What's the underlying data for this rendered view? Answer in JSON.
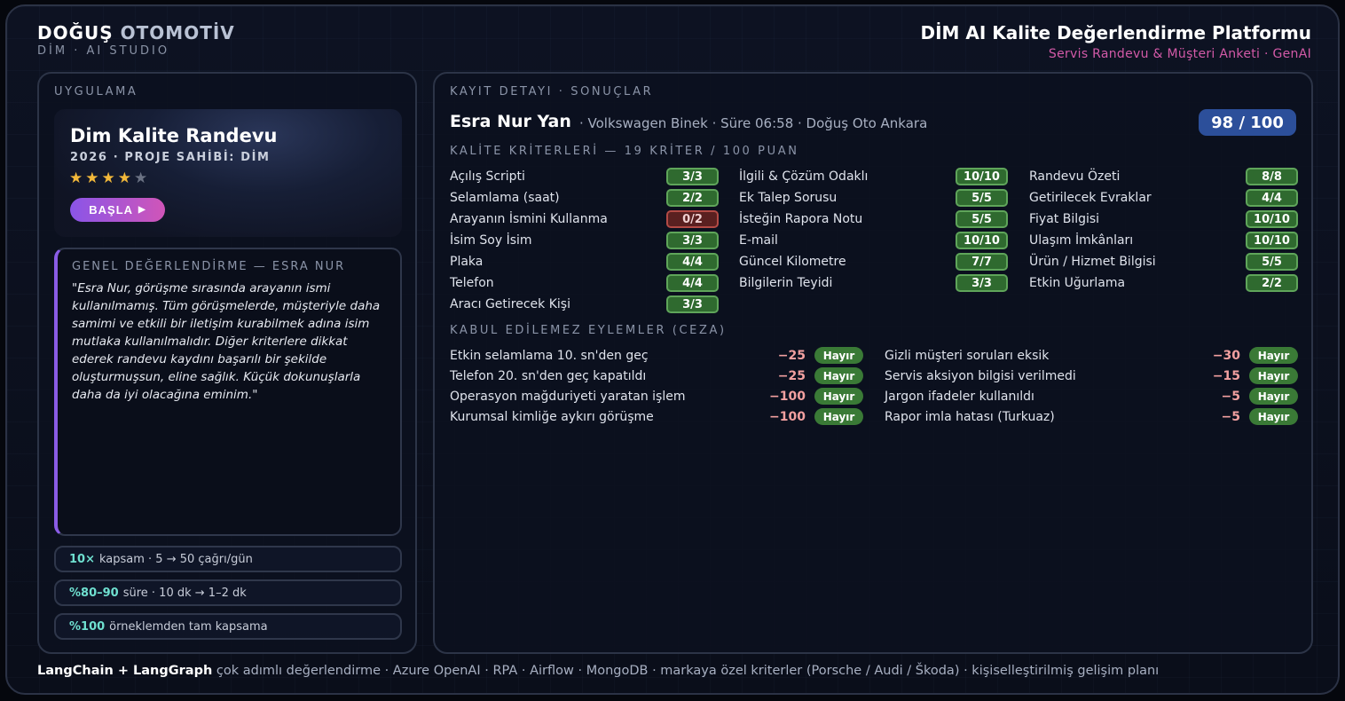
{
  "brand": {
    "name_bold": "DOĞUŞ",
    "name_light": "OTOMOTİV",
    "sub": "DİM · AI STUDIO"
  },
  "platform": {
    "title": "DİM AI Kalite Değerlendirme Platformu",
    "subtitle": "Servis Randevu & Müşteri Anketi · GenAI"
  },
  "left": {
    "caption": "UYGULAMA",
    "app": {
      "title": "Dim Kalite Randevu",
      "owner": "2026 · PROJE SAHİBİ: DİM",
      "rating": 4,
      "rating_max": 5,
      "start_label": "BAŞLA"
    },
    "evaluation": {
      "caption": "GENEL DEĞERLENDİRME — ESRA NUR",
      "text": "\"Esra Nur, görüşme sırasında arayanın ismi kullanılmamış. Tüm görüşmelerde, müşteriyle daha samimi ve etkili bir iletişim kurabilmek adına isim mutlaka kullanılmalıdır. Diğer kriterlere dikkat ederek randevu kaydını başarılı bir şekilde oluşturmuşsun, eline sağlık. Küçük dokunuşlarla daha da iyi olacağına eminim.\""
    },
    "stats": [
      {
        "highlight": "10×",
        "text": "kapsam · 5 → 50 çağrı/gün"
      },
      {
        "highlight": "%80–90",
        "text": "süre · 10 dk → 1–2 dk"
      },
      {
        "highlight": "%100",
        "text": "örneklemden tam kapsama"
      }
    ]
  },
  "right": {
    "caption": "KAYIT DETAYI · SONUÇLAR",
    "record": {
      "name": "Esra Nur Yan",
      "meta": "· Volkswagen Binek · Süre 06:58 · Doğuş Oto Ankara",
      "score": "98 / 100"
    },
    "criteria_caption": "KALİTE KRİTERLERİ — 19 KRİTER / 100 PUAN",
    "criteria_columns": [
      [
        {
          "label": "Açılış Scripti",
          "score": "3/3",
          "pass": true
        },
        {
          "label": "Selamlama (saat)",
          "score": "2/2",
          "pass": true
        },
        {
          "label": "Arayanın İsmini Kullanma",
          "score": "0/2",
          "pass": false
        },
        {
          "label": "İsim Soy İsim",
          "score": "3/3",
          "pass": true
        },
        {
          "label": "Plaka",
          "score": "4/4",
          "pass": true
        },
        {
          "label": "Telefon",
          "score": "4/4",
          "pass": true
        },
        {
          "label": "Aracı Getirecek Kişi",
          "score": "3/3",
          "pass": true
        }
      ],
      [
        {
          "label": "İlgili & Çözüm Odaklı",
          "score": "10/10",
          "pass": true
        },
        {
          "label": "Ek Talep Sorusu",
          "score": "5/5",
          "pass": true
        },
        {
          "label": "İsteğin Rapora Notu",
          "score": "5/5",
          "pass": true
        },
        {
          "label": "E-mail",
          "score": "10/10",
          "pass": true
        },
        {
          "label": "Güncel Kilometre",
          "score": "7/7",
          "pass": true
        },
        {
          "label": "Bilgilerin Teyidi",
          "score": "3/3",
          "pass": true
        }
      ],
      [
        {
          "label": "Randevu Özeti",
          "score": "8/8",
          "pass": true
        },
        {
          "label": "Getirilecek Evraklar",
          "score": "4/4",
          "pass": true
        },
        {
          "label": "Fiyat Bilgisi",
          "score": "10/10",
          "pass": true
        },
        {
          "label": "Ulaşım İmkânları",
          "score": "10/10",
          "pass": true
        },
        {
          "label": "Ürün / Hizmet Bilgisi",
          "score": "5/5",
          "pass": true
        },
        {
          "label": "Etkin Uğurlama",
          "score": "2/2",
          "pass": true
        }
      ]
    ],
    "penalty_caption": "KABUL EDİLEMEZ EYLEMLER (CEZA)",
    "penalty_columns": [
      [
        {
          "label": "Etkin selamlama 10. sn'den geç",
          "points": "−25",
          "status": "Hayır"
        },
        {
          "label": "Telefon 20. sn'den geç kapatıldı",
          "points": "−25",
          "status": "Hayır"
        },
        {
          "label": "Operasyon mağduriyeti yaratan işlem",
          "points": "−100",
          "status": "Hayır"
        },
        {
          "label": "Kurumsal kimliğe aykırı görüşme",
          "points": "−100",
          "status": "Hayır"
        }
      ],
      [
        {
          "label": "Gizli müşteri soruları eksik",
          "points": "−30",
          "status": "Hayır"
        },
        {
          "label": "Servis aksiyon bilgisi verilmedi",
          "points": "−15",
          "status": "Hayır"
        },
        {
          "label": "Jargon ifadeler kullanıldı",
          "points": "−5",
          "status": "Hayır"
        },
        {
          "label": "Rapor imla hatası (Turkuaz)",
          "points": "−5",
          "status": "Hayır"
        }
      ]
    ]
  },
  "footer": {
    "bold": "LangChain + LangGraph",
    "text": " çok adımlı değerlendirme · Azure OpenAI · RPA · Airflow · MongoDB · markaya özel kriterler (Porsche / Audi / Škoda) · kişiselleştirilmiş gelişim planı"
  },
  "colors": {
    "accent_pink": "#d35aa8",
    "accent_purple": "#8a5ce6",
    "score_blue": "#2c4f9a",
    "pass_green": "#5fa55a",
    "fail_red": "#b34a45",
    "highlight_teal": "#6fe0d0",
    "star_gold": "#f2b83a"
  },
  "icons": {
    "play": "play-icon",
    "star": "star-icon"
  }
}
